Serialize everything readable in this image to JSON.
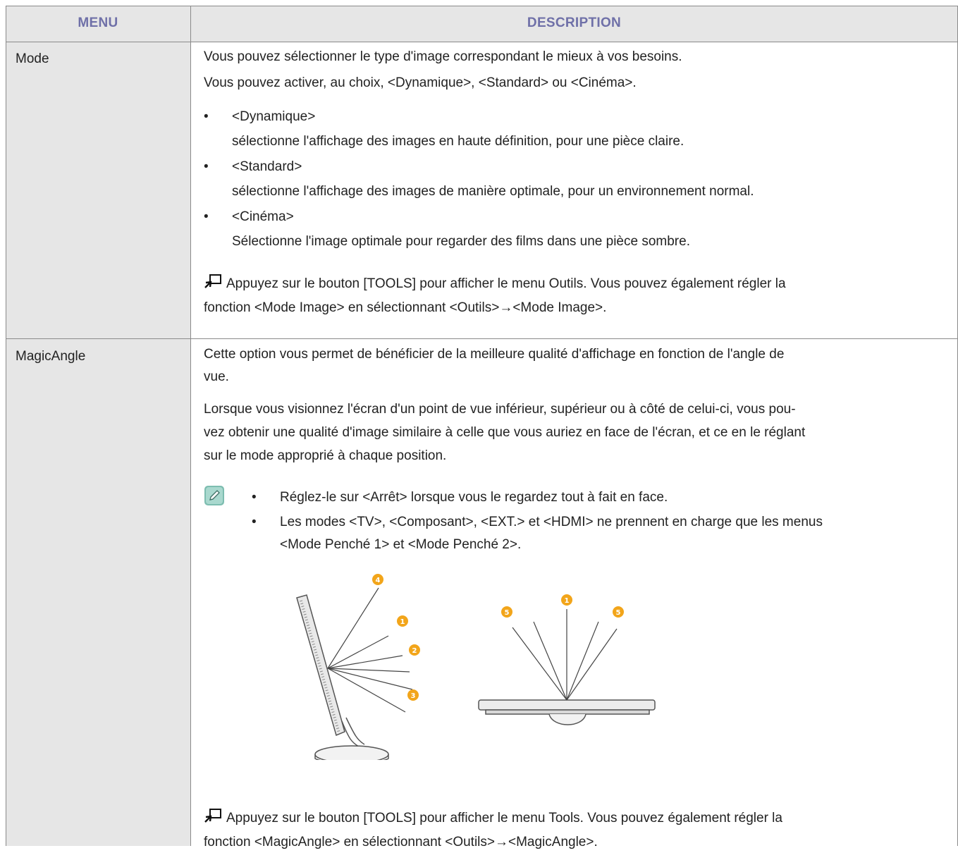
{
  "header": {
    "menu": "MENU",
    "description": "DESCRIPTION"
  },
  "rows": [
    {
      "menu": "Mode",
      "lines": [
        "Vous pouvez sélectionner le type d'image correspondant le mieux à vos besoins.",
        "Vous pouvez activer, au choix, <Dynamique>, <Standard> ou <Cinéma>."
      ],
      "bullets": [
        {
          "title": "<Dynamique>",
          "text": "sélectionne l'affichage des images en haute définition, pour une pièce claire."
        },
        {
          "title": "<Standard>",
          "text": "sélectionne l'affichage des images de manière optimale, pour un environnement normal."
        },
        {
          "title": "<Cinéma>",
          "text": "Sélectionne l'image optimale pour regarder des films dans une pièce sombre."
        }
      ],
      "tools_line1": "Appuyez sur le bouton [TOOLS] pour afficher le menu Outils. Vous pouvez également régler la",
      "tools_line2": "fonction <Mode Image> en sélectionnant <Outils>→<Mode Image>."
    },
    {
      "menu": "MagicAngle",
      "intro1": "Cette option vous permet de bénéficier de la meilleure qualité d'affichage en fonction de l'angle de",
      "intro2": "vue.",
      "para1": "Lorsque vous visionnez l'écran d'un point de vue inférieur, supérieur ou à côté de celui-ci, vous pou-",
      "para2": "vez obtenir une qualité d'image similaire à celle que vous auriez en face de l'écran, et ce en le réglant",
      "para3": "sur le mode approprié à chaque position.",
      "notes": [
        "Réglez-le sur <Arrêt> lorsque vous le regardez tout à fait en face.",
        "Les modes <TV>, <Composant>, <EXT.> et <HDMI> ne prennent en charge que les menus",
        "<Mode Penché 1> et <Mode Penché 2>."
      ],
      "tools_line1": "Appuyez sur le bouton [TOOLS] pour afficher le menu Tools. Vous pouvez également régler la",
      "tools_line2": "fonction <MagicAngle> en sélectionnant <Outils>→<MagicAngle>."
    }
  ],
  "bullet_char": "•",
  "note_icon": "note-pencil-icon",
  "tools_icon": "remote-tools-icon",
  "diagram_numbers": [
    "4",
    "1",
    "2",
    "3",
    "5",
    "1",
    "5"
  ],
  "colors": {
    "header_text": "#6f70a8",
    "menu_bg": "#e6e6e6",
    "badge": "#f2a51a",
    "note_icon": "#7dbdb0"
  }
}
